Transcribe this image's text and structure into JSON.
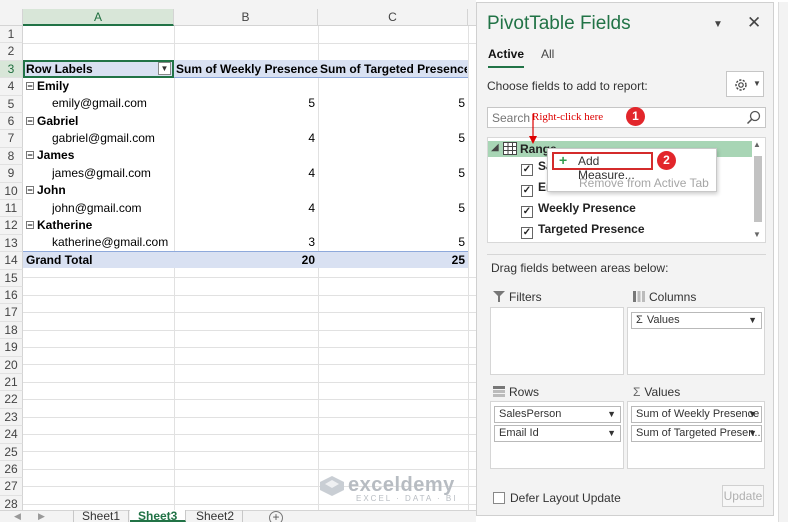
{
  "sheet": {
    "columns": [
      "A",
      "B",
      "C"
    ],
    "rows": [
      "1",
      "2",
      "3",
      "4",
      "5",
      "6",
      "7",
      "8",
      "9",
      "10",
      "11",
      "12",
      "13",
      "14",
      "15",
      "16",
      "17",
      "18",
      "19",
      "20",
      "21",
      "22",
      "23",
      "24",
      "25",
      "26",
      "27",
      "28"
    ],
    "header": {
      "row_labels": "Row Labels",
      "sum_weekly": "Sum of Weekly Presence",
      "sum_targeted": "Sum of Targeted Presence"
    },
    "people": [
      {
        "name": "Emily",
        "email": "emily@gmail.com",
        "weekly": "5",
        "targeted": "5"
      },
      {
        "name": "Gabriel",
        "email": "gabriel@gmail.com",
        "weekly": "4",
        "targeted": "5"
      },
      {
        "name": "James",
        "email": "james@gmail.com",
        "weekly": "4",
        "targeted": "5"
      },
      {
        "name": "John",
        "email": "john@gmail.com",
        "weekly": "4",
        "targeted": "5"
      },
      {
        "name": "Katherine",
        "email": "katherine@gmail.com",
        "weekly": "3",
        "targeted": "5"
      }
    ],
    "total": {
      "label": "Grand Total",
      "weekly": "20",
      "targeted": "25"
    },
    "tabs": [
      "Sheet1",
      "Sheet3",
      "Sheet2"
    ],
    "active_tab": "Sheet3",
    "watermark": {
      "name": "exceldemy",
      "tagline": "EXCEL · DATA · BI"
    }
  },
  "pane": {
    "title": "PivotTable Fields",
    "tabs": {
      "active": "Active",
      "all": "All"
    },
    "choose_text": "Choose fields to add to report:",
    "search_placeholder": "Search",
    "range_label": "Range",
    "fields": [
      "Sa",
      "Em",
      "Weekly Presence",
      "Targeted Presence"
    ],
    "drag_text": "Drag fields between areas below:",
    "areas": {
      "filters": "Filters",
      "columns": "Columns",
      "rows": "Rows",
      "values": "Values"
    },
    "columns_items": [
      "Values"
    ],
    "rows_items": [
      "SalesPerson",
      "Email Id"
    ],
    "values_items": [
      "Sum of Weekly Presence",
      "Sum of Targeted Presen..."
    ],
    "defer_label": "Defer Layout Update",
    "update_label": "Update"
  },
  "context_menu": {
    "add_measure": "Add Measure...",
    "remove": "Remove from Active Tab"
  },
  "annotation": {
    "text": "Right-click here",
    "badge1": "1",
    "badge2": "2"
  },
  "colors": {
    "excel_green": "#217346",
    "pivot_header_fill": "#d9e1f2",
    "highlight_red": "#e2262b",
    "range_row_fill": "#a8d5b5"
  }
}
